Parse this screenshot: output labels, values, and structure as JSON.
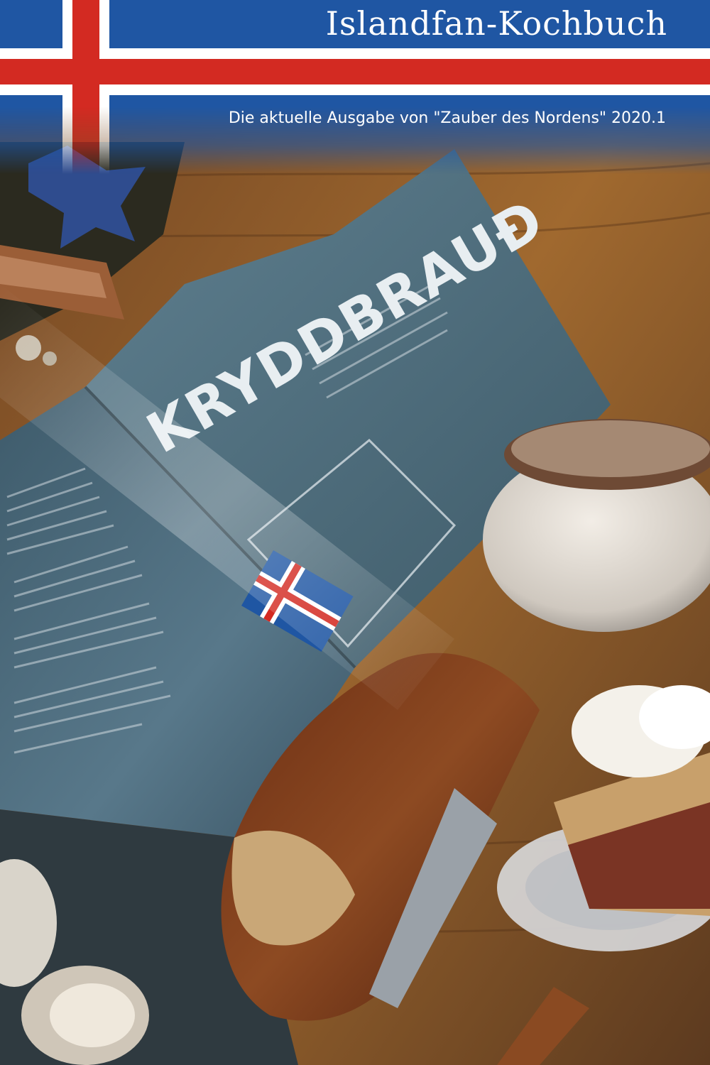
{
  "header": {
    "title": "Islandfan-Kochbuch",
    "subtitle": "Die aktuelle Ausgabe von \"Zauber des Nordens\" 2020.1"
  },
  "photo": {
    "magazine_heading": "KRYDDBRAUÐ"
  },
  "colors": {
    "flag_blue": "#1f56a3",
    "flag_red": "#d32a22",
    "flag_white": "#ffffff",
    "magazine_teal": "#4d6a78",
    "table_wood": "#8a5a2c"
  }
}
